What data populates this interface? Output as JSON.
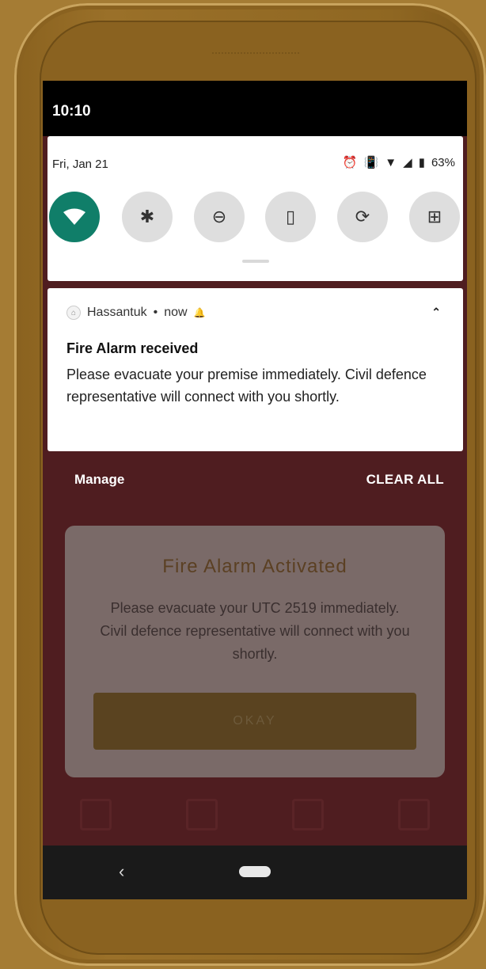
{
  "status": {
    "time": "10:10",
    "battery": "63%"
  },
  "quick_settings": {
    "date": "Fri, Jan 21",
    "tiles": [
      {
        "id": "wifi",
        "icon": "wifi-icon",
        "active": true
      },
      {
        "id": "bluetooth",
        "icon": "bluetooth-icon",
        "active": false
      },
      {
        "id": "dnd",
        "icon": "do-not-disturb-icon",
        "active": false
      },
      {
        "id": "flashlight",
        "icon": "flashlight-icon",
        "active": false
      },
      {
        "id": "rotate",
        "icon": "auto-rotate-icon",
        "active": false
      },
      {
        "id": "battery-saver",
        "icon": "battery-saver-icon",
        "active": false
      }
    ]
  },
  "notification": {
    "app": "Hassantuk",
    "time": "now",
    "title": "Fire Alarm received",
    "body": "Please evacuate your premise immediately. Civil defence representative will connect with you shortly."
  },
  "shade_actions": {
    "manage": "Manage",
    "clear_all": "CLEAR ALL"
  },
  "dialog": {
    "title": "Fire Alarm Activated",
    "body": "Please evacuate your UTC  2519 immediately. Civil defence representative will connect with you shortly.",
    "button": "OKAY"
  },
  "colors": {
    "accent": "#107e69",
    "background": "#4f1d20",
    "device": "#a57c34"
  }
}
